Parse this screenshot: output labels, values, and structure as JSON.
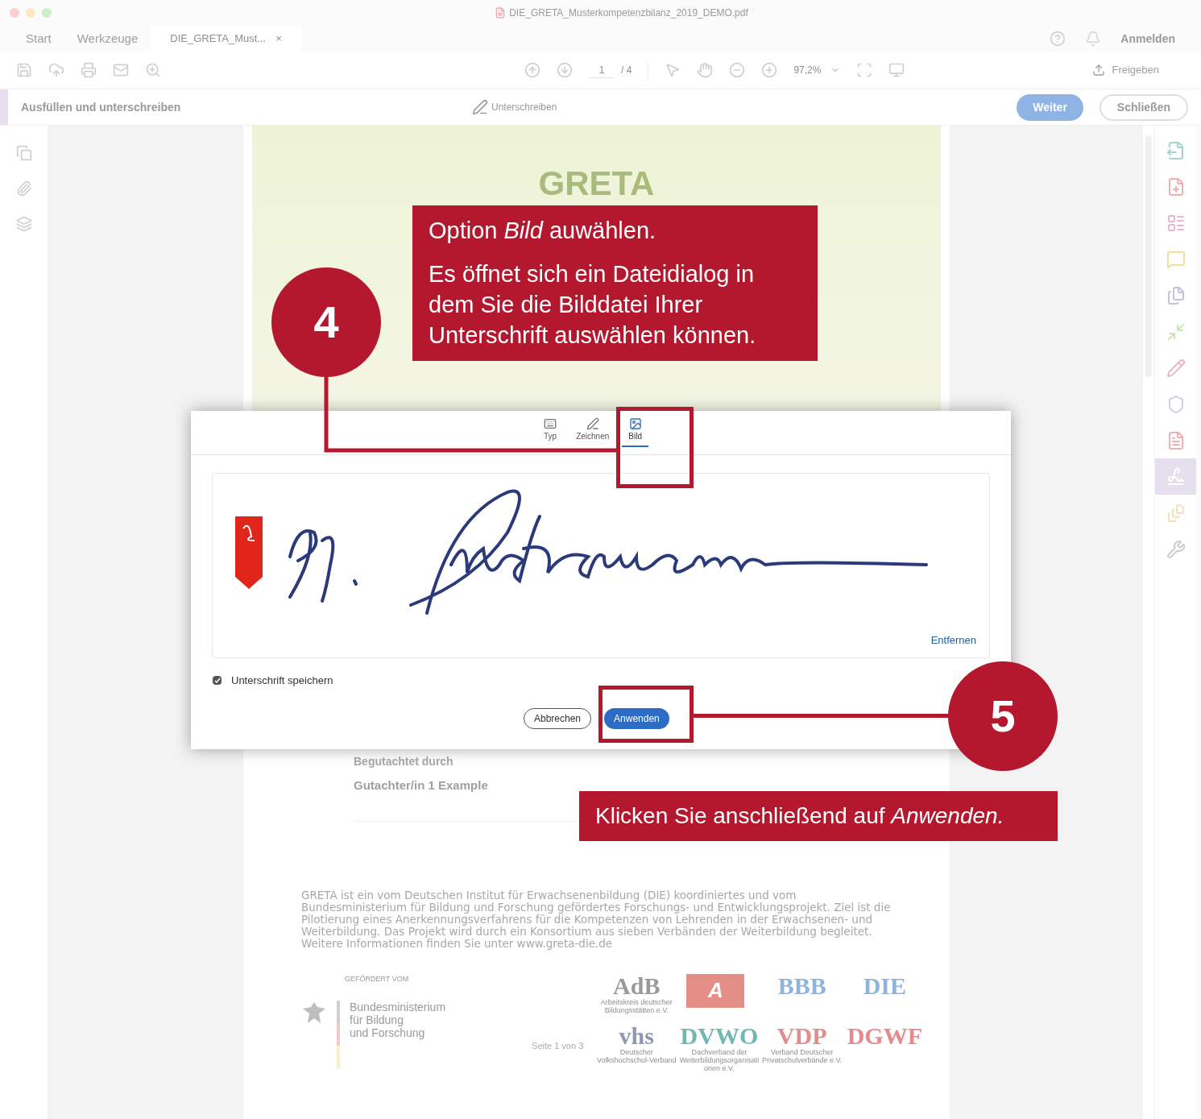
{
  "window": {
    "title": "DIE_GRETA_Musterkompetenzbilanz_2019_DEMO.pdf"
  },
  "nav_tabs": [
    {
      "label": "Start",
      "selected": false
    },
    {
      "label": "Werkzeuge",
      "selected": false
    },
    {
      "label": "DIE_GRETA_Must...",
      "close": "×",
      "selected": true
    }
  ],
  "account": {
    "login": "Anmelden"
  },
  "toolbar": {
    "page": "1",
    "page_count": "/ 4",
    "zoom": "97,2%",
    "share": "Freigeben"
  },
  "fill_sign_bar": {
    "title": "Ausfüllen und unterschreiben",
    "sign": "Unterschreiben",
    "next": "Weiter",
    "close": "Schließen"
  },
  "right_tools": [
    {
      "kind": "export",
      "color": "#9fd6d2",
      "selected": false
    },
    {
      "kind": "create",
      "color": "#f2aeb4",
      "selected": false
    },
    {
      "kind": "organize",
      "color": "#efb6cf",
      "selected": false
    },
    {
      "kind": "comment",
      "color": "#f1dd9c",
      "selected": false
    },
    {
      "kind": "combine",
      "color": "#c6c0e2",
      "selected": false
    },
    {
      "kind": "compress",
      "color": "#c8e4b8",
      "selected": false
    },
    {
      "kind": "edit",
      "color": "#f1b2c4",
      "selected": false
    },
    {
      "kind": "protect",
      "color": "#d4d0e4",
      "selected": false
    },
    {
      "kind": "pdf",
      "color": "#f2aeb4",
      "selected": false
    },
    {
      "kind": "sign",
      "color": "#ffffff",
      "selected": true
    },
    {
      "kind": "more",
      "color": "#f3e3b4",
      "selected": false
    },
    {
      "kind": "add",
      "color": "#cccccc",
      "selected": false
    }
  ],
  "page": {
    "logo": "GRETA",
    "reviewed_label": "Begutachtet durch",
    "reviewer": "Gutachter/in 1 Example",
    "about": "GRETA ist ein vom Deutschen Institut für Erwachsenenbildung (DIE) koordiniertes und vom Bundesministerium für Bildung und Forschung gefördertes Forschungs- und Entwicklungsprojekt. Ziel ist die Pilotierung eines Anerkennungsverfahrens für die Kompetenzen von Lehrenden in der Erwachsenen- und Weiterbildung. Das Projekt wird durch ein Konsortium aus sieben Verbänden der Weiterbildung begleitet. Weitere Informationen finden Sie unter www.greta-die.de",
    "funded_by": "GEFÖRDERT VOM",
    "ministry": [
      "Bundesministerium",
      "für Bildung",
      "und Forschung"
    ],
    "page_info": "Seite 1 von 3",
    "partners": [
      {
        "kind": "text",
        "name": "AdB",
        "caption": "Arbeitskreis deutscher Bildungsstätten e.V.",
        "color": "#9a9a9a"
      },
      {
        "kind": "badge",
        "name": "A",
        "color": "#e38f88"
      },
      {
        "kind": "text",
        "name": "BBB",
        "color": "#8fb4dc"
      },
      {
        "kind": "text",
        "name": "DIE",
        "color": "#8fb4dc"
      },
      {
        "kind": "text",
        "name": "vhs",
        "caption": "Deutscher Volkshochschul-Verband",
        "color": "#8e98b0"
      },
      {
        "kind": "text",
        "name": "DVWO",
        "caption": "Dachverband der Weiterbildungsorganisationen e.V.",
        "color": "#6fb8b0"
      },
      {
        "kind": "text",
        "name": "VDP",
        "caption": "Verband Deutscher Privatschulverbände e.V.",
        "color": "#e08d8d"
      },
      {
        "kind": "text",
        "name": "DGWF",
        "color": "#e8898f"
      }
    ]
  },
  "signature_dialog": {
    "tabs": [
      {
        "kind": "keyboard",
        "label": "Typ",
        "selected": false
      },
      {
        "kind": "draw",
        "label": "Zeichnen",
        "selected": false
      },
      {
        "kind": "image",
        "label": "Bild",
        "selected": true
      }
    ],
    "remove": "Entfernen",
    "save": {
      "label": "Unterschrift speichern",
      "checked": true
    },
    "cancel": "Abbrechen",
    "apply": "Anwenden"
  },
  "steps": [
    {
      "number": "4",
      "text": [
        "Option *Bild* auwählen.",
        "Es öffnet sich ein Dateidialog in dem Sie die Bilddatei Ihrer Unterschrift auswählen können."
      ]
    },
    {
      "number": "5",
      "text": [
        "Klicken Sie anschließend auf *Anwenden.*"
      ]
    }
  ]
}
